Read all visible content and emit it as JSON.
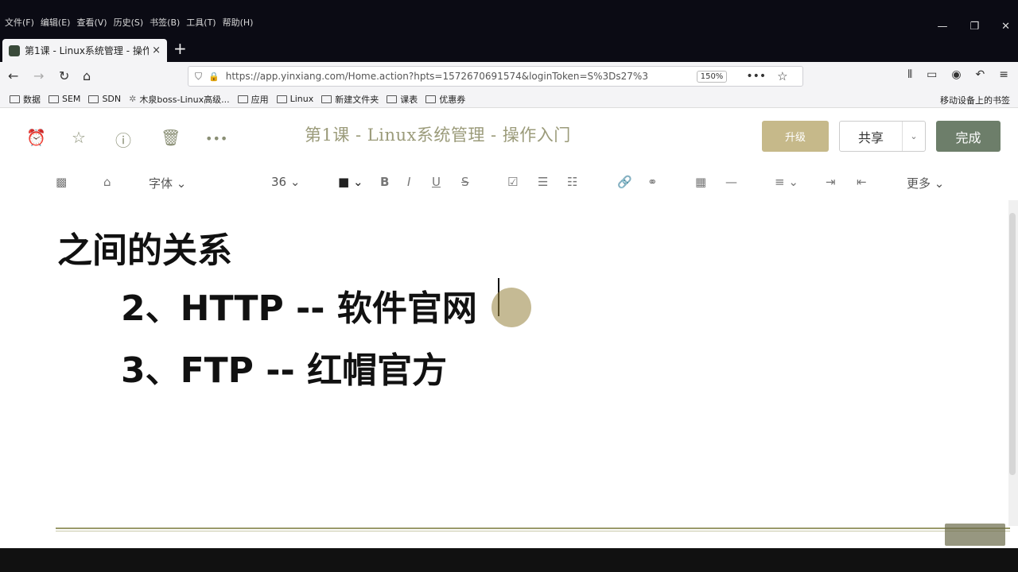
{
  "browser": {
    "menu": [
      "文件(F)",
      "编辑(E)",
      "查看(V)",
      "历史(S)",
      "书签(B)",
      "工具(T)",
      "帮助(H)"
    ],
    "tab_title": "第1课 - Linux系统管理 - 操作入",
    "tab_close": "×",
    "new_tab": "+",
    "url": "https://app.yinxiang.com/Home.action?hpts=1572670691574&loginToken=S%3Ds27%3",
    "zoom": "150%",
    "bookmarks": [
      "数据",
      "SEM",
      "SDN",
      "木泉boss-Linux高级...",
      "应用",
      "Linux",
      "新建文件夹",
      "课表",
      "优惠券"
    ],
    "mobile_bookmarks": "移动设备上的书签"
  },
  "editor": {
    "note_title": "第1课 - Linux系统管理 - 操作入门",
    "upgrade_label": "升级",
    "share_label": "共享",
    "done_label": "完成",
    "font_label": "字体",
    "font_size": "36",
    "more_label": "更多"
  },
  "content": {
    "heading": "之间的关系",
    "line1": "2、HTTP -- 软件官网",
    "line2": "3、FTP -- 红帽官方"
  },
  "colors": {
    "accent_done": "#6d7e6a",
    "accent_upgrade": "#c6b98a",
    "title_color": "#9b9b7a"
  }
}
